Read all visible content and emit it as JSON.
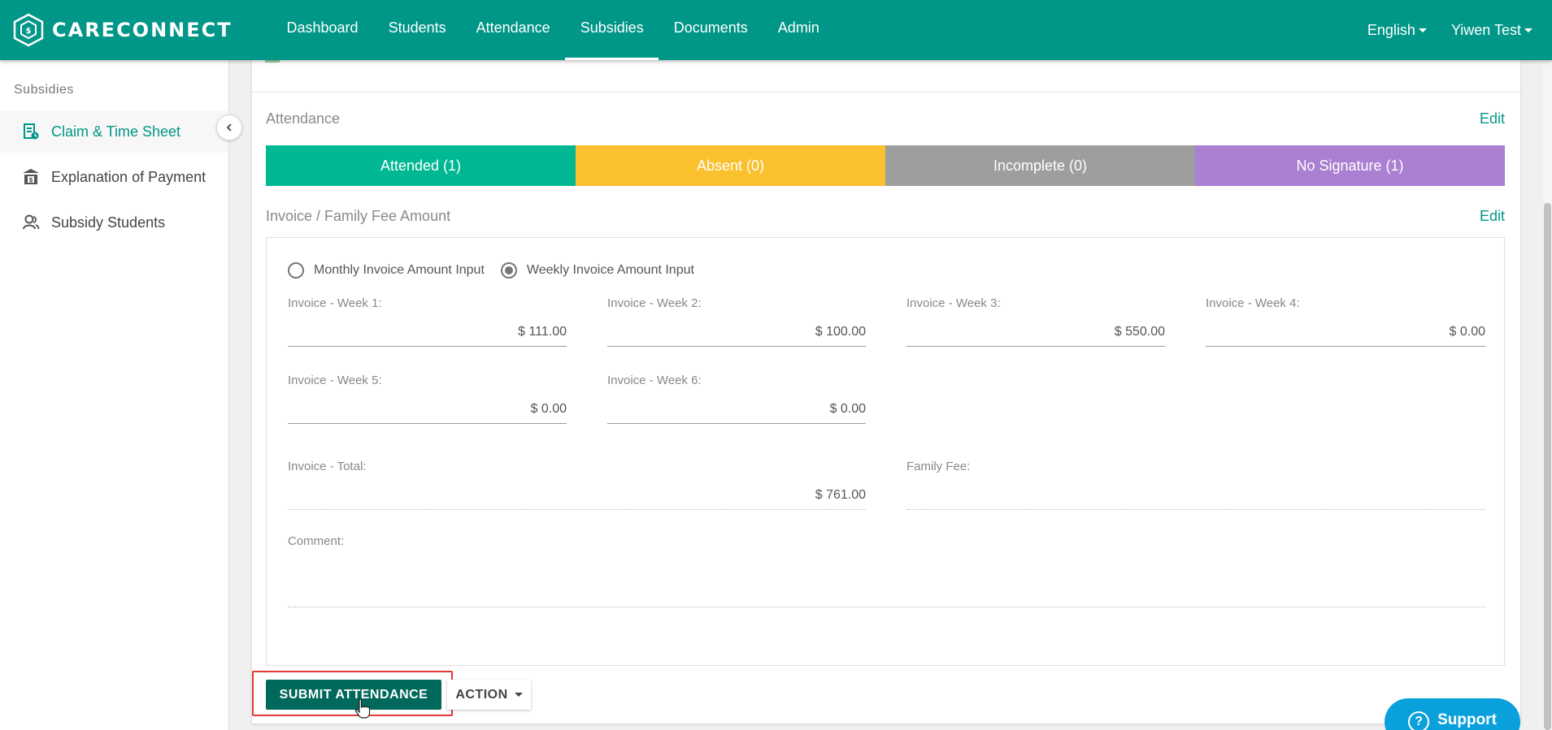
{
  "app": {
    "brand": "CARECONNECT"
  },
  "nav": {
    "items": [
      {
        "label": "Dashboard",
        "active": false
      },
      {
        "label": "Students",
        "active": false
      },
      {
        "label": "Attendance",
        "active": false
      },
      {
        "label": "Subsidies",
        "active": true
      },
      {
        "label": "Documents",
        "active": false
      },
      {
        "label": "Admin",
        "active": false
      }
    ],
    "language": "English",
    "user": "Yiwen Test"
  },
  "sidebar": {
    "heading": "Subsidies",
    "items": [
      {
        "label": "Claim & Time Sheet",
        "icon": "claim-sheet-icon",
        "active": true
      },
      {
        "label": "Explanation of Payment",
        "icon": "payment-bank-icon",
        "active": false
      },
      {
        "label": "Subsidy Students",
        "icon": "students-icon",
        "active": false
      }
    ]
  },
  "attendance": {
    "title": "Attendance",
    "edit_label": "Edit",
    "segments": [
      {
        "label": "Attended (1)",
        "color": "#00b894"
      },
      {
        "label": "Absent (0)",
        "color": "#fbc02d"
      },
      {
        "label": "Incomplete (0)",
        "color": "#9e9e9e"
      },
      {
        "label": "No Signature (1)",
        "color": "#ab7fd1"
      }
    ]
  },
  "invoice": {
    "title": "Invoice / Family Fee Amount",
    "edit_label": "Edit",
    "radio_monthly": "Monthly Invoice Amount Input",
    "radio_weekly": "Weekly Invoice Amount Input",
    "selected_mode": "weekly",
    "weeks": [
      {
        "label": "Invoice - Week 1:",
        "value": "$ 111.00"
      },
      {
        "label": "Invoice - Week 2:",
        "value": "$ 100.00"
      },
      {
        "label": "Invoice - Week 3:",
        "value": "$ 550.00"
      },
      {
        "label": "Invoice - Week 4:",
        "value": "$ 0.00"
      },
      {
        "label": "Invoice - Week 5:",
        "value": "$ 0.00"
      },
      {
        "label": "Invoice - Week 6:",
        "value": "$ 0.00"
      }
    ],
    "total_label": "Invoice - Total:",
    "total_value": "$ 761.00",
    "family_fee_label": "Family Fee:",
    "family_fee_value": "",
    "comment_label": "Comment:",
    "comment_value": ""
  },
  "actions": {
    "submit_label": "SUBMIT ATTENDANCE",
    "action_label": "ACTION"
  },
  "support": {
    "label": "Support"
  }
}
